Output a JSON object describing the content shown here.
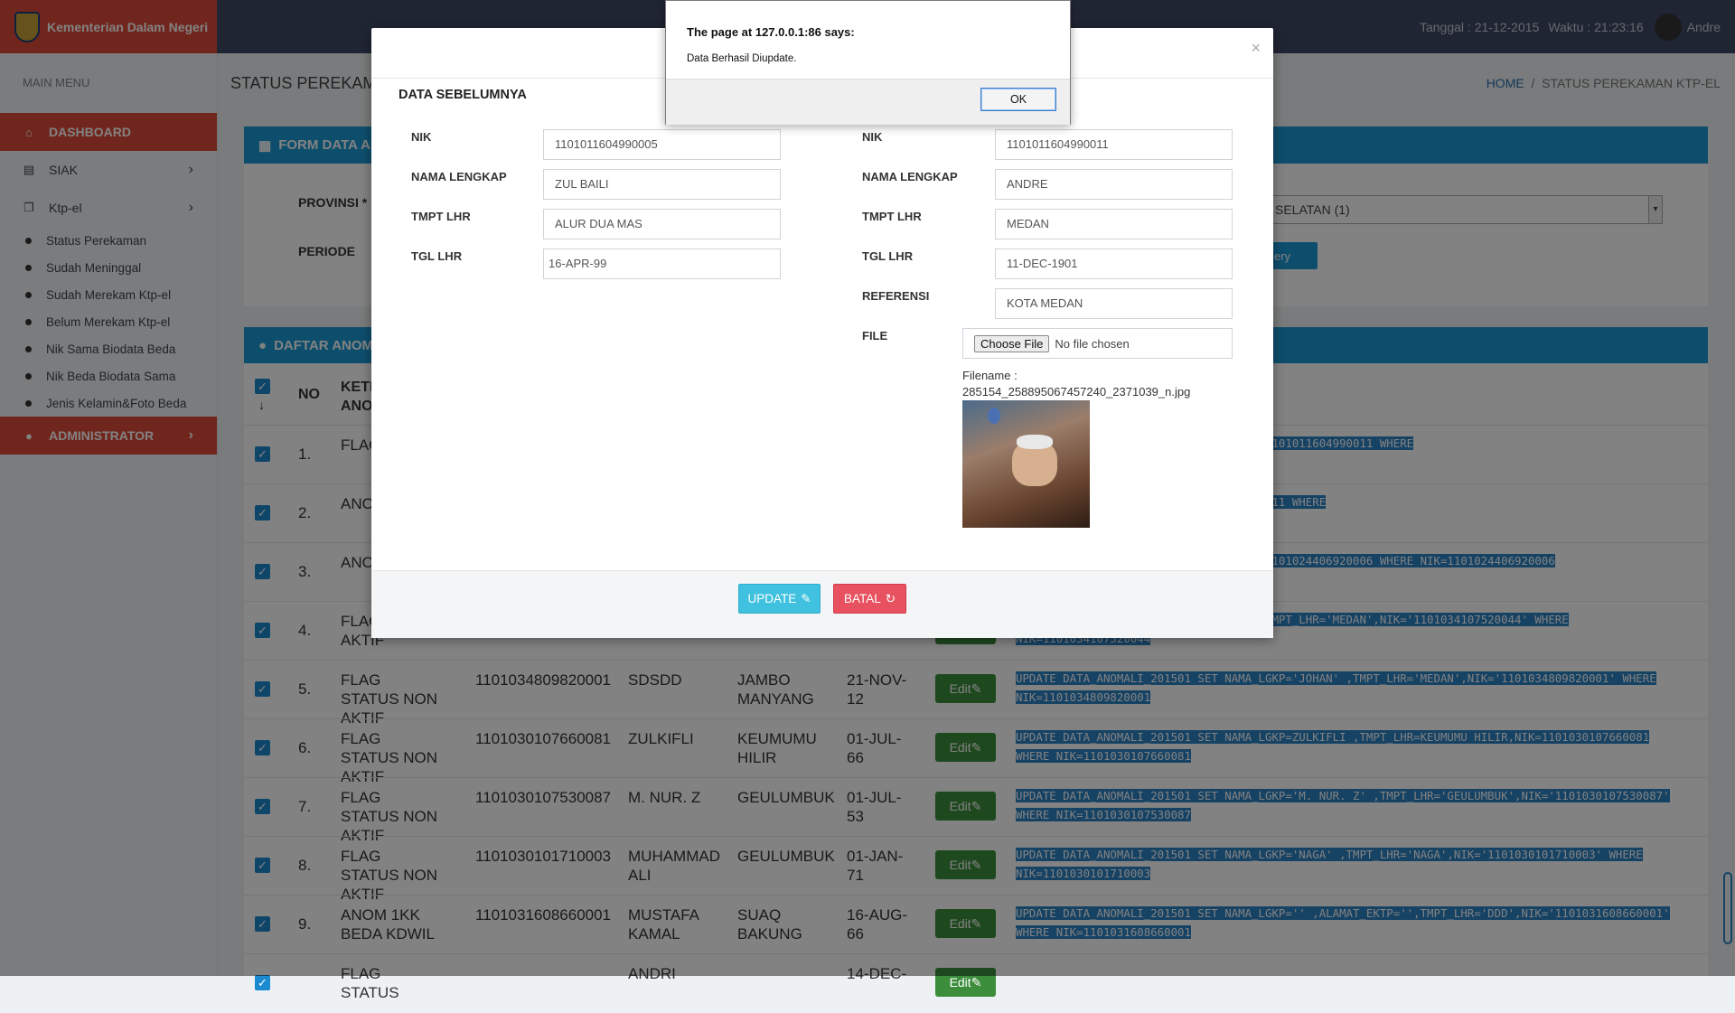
{
  "app": {
    "brand": "Kementerian Dalam Negeri",
    "date_label": "Tanggal : 21-12-2015",
    "time_label": "Waktu : 21:23:16",
    "user": "Andre"
  },
  "sidebar": {
    "menu_title": "MAIN MENU",
    "items": [
      {
        "label": "DASHBOARD",
        "icon": "home-icon"
      },
      {
        "label": "SIAK",
        "icon": "list-icon"
      },
      {
        "label": "Ktp-el",
        "icon": "files-icon"
      }
    ],
    "sub_items": [
      "Status Perekaman",
      "Sudah Meninggal",
      "Sudah Merekam Ktp-el",
      "Belum Merekam Ktp-el",
      "Nik Sama Biodata Beda",
      "Nik Beda Biodata Sama",
      "Jenis Kelamin&Foto Beda"
    ],
    "admin_label": "ADMINISTRATOR"
  },
  "page": {
    "title": "STATUS PEREKAM",
    "breadcrumb_home": "HOME",
    "breadcrumb_current": "STATUS PEREKAMAN KTP-EL"
  },
  "form_panel": {
    "title": "FORM DATA AN",
    "provinsi_label": "PROVINSI *",
    "periode_label": "PERIODE",
    "select_value": "SELATAN (1)",
    "query_button": "ery"
  },
  "list_panel": {
    "title": "DAFTAR ANOM",
    "headers": {
      "no": "NO",
      "keterangan": "KETE ANO"
    }
  },
  "rows": [
    {
      "no": "1.",
      "ket": "FLAG NON",
      "sql": "_LGKP='ANDRE' ,TMPT_LHR='MEDAN',NIK='1101011604990011 WHERE"
    },
    {
      "no": "2.",
      "ket": "ANO BEDA",
      "sql": "_LGKP='ASAS' ,TMPT_LHR='SASAS',NIK=11111 WHERE"
    },
    {
      "no": "3.",
      "ket": "ANO BEDA",
      "sql": "_LGKP='ANISAH MUNIAR' ,ALAMAT='DUSUN 1101024406920006 WHERE NIK=1101024406920006"
    },
    {
      "no": "4.",
      "ket": "FLAG NON AKTIF",
      "sql": "_LGKP='ARIANI' ,ALAMAT='JL.SUKADONO',TMPT_LHR='MEDAN',NIK='1101034107520044' WHERE NIK=1101034107520044"
    },
    {
      "no": "5.",
      "ket": "FLAG STATUS NON AKTIF",
      "nik": "1101034809820001",
      "nama": "SDSDD",
      "tmpt": "JAMBO MANYANG",
      "tgl": "21-NOV-12",
      "sql": "UPDATE DATA_ANOMALI_201501 SET NAMA_LGKP='JOHAN' ,TMPT_LHR='MEDAN',NIK='1101034809820001' WHERE NIK=1101034809820001"
    },
    {
      "no": "6.",
      "ket": "FLAG STATUS NON AKTIF",
      "nik": "1101030107660081",
      "nama": "ZULKIFLI",
      "tmpt": "KEUMUMU HILIR",
      "tgl": "01-JUL-66",
      "sql": "UPDATE DATA_ANOMALI_201501 SET NAMA_LGKP=ZULKIFLI ,TMPT_LHR=KEUMUMU HILIR,NIK=1101030107660081 WHERE NIK=1101030107660081"
    },
    {
      "no": "7.",
      "ket": "FLAG STATUS NON AKTIF",
      "nik": "1101030107530087",
      "nama": "M. NUR. Z",
      "tmpt": "GEULUMBUK",
      "tgl": "01-JUL-53",
      "sql": "UPDATE DATA_ANOMALI_201501 SET NAMA_LGKP='M. NUR. Z' ,TMPT_LHR='GEULUMBUK',NIK='1101030107530087' WHERE NIK=1101030107530087"
    },
    {
      "no": "8.",
      "ket": "FLAG STATUS NON AKTIF",
      "nik": "1101030101710003",
      "nama": "MUHAMMAD ALI",
      "tmpt": "GEULUMBUK",
      "tgl": "01-JAN-71",
      "sql": "UPDATE DATA_ANOMALI_201501 SET NAMA_LGKP='NAGA' ,TMPT_LHR='NAGA',NIK='1101030101710003' WHERE NIK=1101030101710003"
    },
    {
      "no": "9.",
      "ket": "ANOM 1KK BEDA KDWIL",
      "nik": "1101031608660001",
      "nama": "MUSTAFA KAMAL",
      "tmpt": "SUAQ BAKUNG",
      "tgl": "16-AUG-66",
      "sql": "UPDATE DATA_ANOMALI_201501 SET NAMA_LGKP='' ,ALAMAT_EKTP='',TMPT_LHR='DDD',NIK='1101031608660001' WHERE NIK=1101031608660001"
    },
    {
      "no": "",
      "ket": "FLAG STATUS",
      "nik": "",
      "nama": "ANDRI",
      "tmpt": "",
      "tgl": "14-DEC-",
      "sql": ""
    }
  ],
  "edit_label": "Edit",
  "modal": {
    "section_title": "DATA SEBELUMNYA",
    "left_labels": [
      "NIK",
      "NAMA LENGKAP",
      "TMPT LHR",
      "TGL LHR"
    ],
    "left_values": [
      "1101011604990005",
      "ZUL BAILI",
      "ALUR DUA MAS",
      "16-APR-99"
    ],
    "right_labels": [
      "NIK",
      "NAMA LENGKAP",
      "TMPT LHR",
      "TGL LHR",
      "REFERENSI",
      "FILE"
    ],
    "right_values": [
      "1101011604990011",
      "ANDRE",
      "MEDAN",
      "11-DEC-1901",
      "KOTA MEDAN"
    ],
    "file_button": "Choose File",
    "file_status": "No file chosen",
    "filename_label": "Filename :",
    "filename": "285154_258895067457240_2371039_n.jpg",
    "update_label": "UPDATE",
    "batal_label": "BATAL"
  },
  "alert": {
    "title": "The page at 127.0.0.1:86 says:",
    "message": "Data Berhasil Diupdate.",
    "ok_label": "OK"
  }
}
